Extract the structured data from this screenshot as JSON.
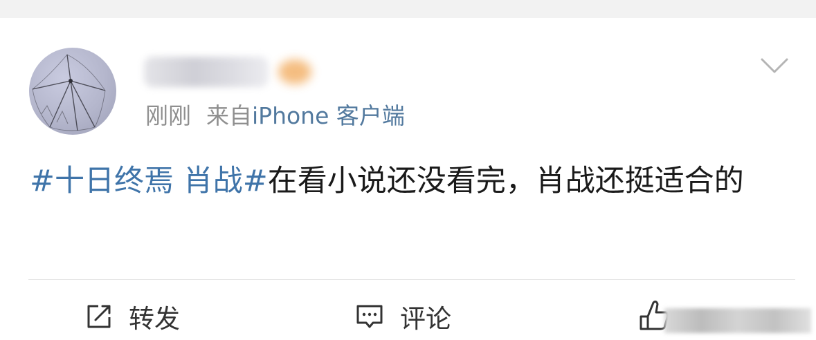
{
  "post": {
    "timestamp": "刚刚",
    "source_prefix": "来自",
    "source_client": "iPhone 客户端",
    "topic": "#十日终焉 肖战#",
    "body": "在看小说还没看完，肖战还挺适合的"
  },
  "actions": {
    "repost_label": "转发",
    "comment_label": "评论"
  },
  "colors": {
    "topic_link": "#3f74a9",
    "client_link": "#52799e",
    "meta_gray": "#8f8f8f",
    "text": "#1a1a1a"
  },
  "icons": {
    "menu": "chevron-down-icon",
    "repost": "repost-icon",
    "comment": "comment-icon",
    "like": "like-icon"
  }
}
